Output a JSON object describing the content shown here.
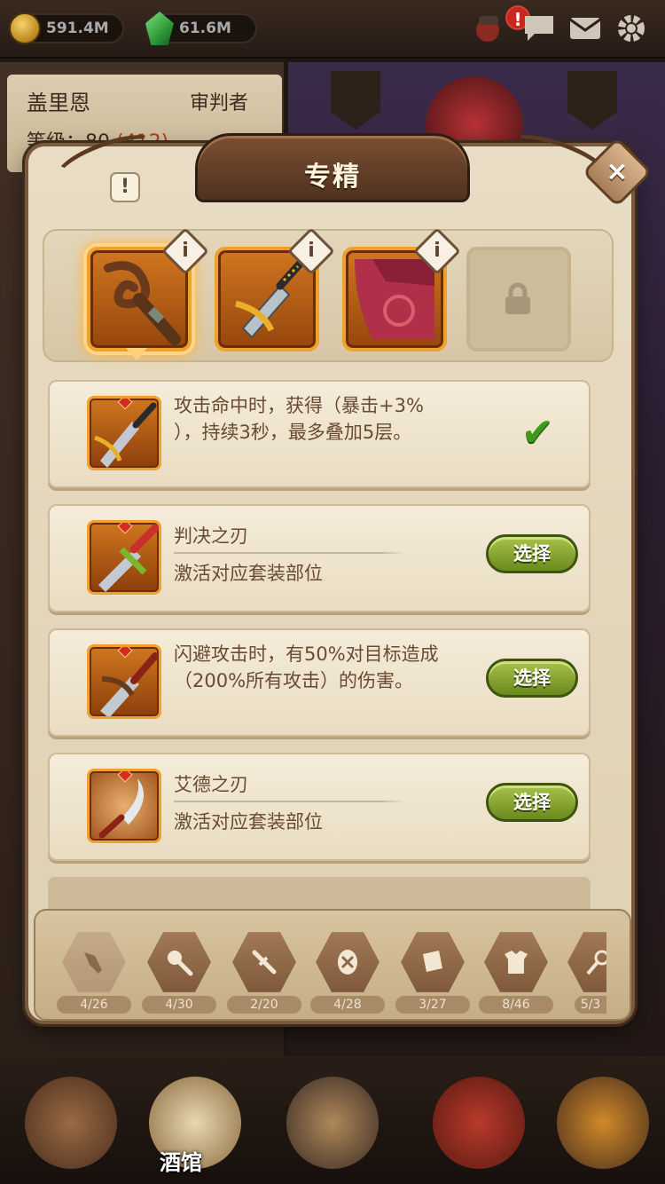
{
  "hud": {
    "gold": "591.4M",
    "gems": "61.6M",
    "alert_badge": "!",
    "icons": [
      "hero-portrait-icon",
      "chat-icon",
      "mail-icon",
      "gear-icon"
    ]
  },
  "hero_card": {
    "name": "盖里恩",
    "role": "审判者",
    "level_label": "等级：80",
    "level_extra": "(412)"
  },
  "dialog": {
    "title": "专精",
    "info_mark": "!",
    "close_label": "×"
  },
  "slots": [
    {
      "icon": "staff-icon",
      "selected": true,
      "info": "i"
    },
    {
      "icon": "dagger-icon",
      "selected": false,
      "info": "i"
    },
    {
      "icon": "cape-icon",
      "selected": false,
      "info": "i"
    },
    {
      "icon": "lock-icon",
      "locked": true
    }
  ],
  "options": [
    {
      "desc_line1": "攻击命中时，获得（暴击+3%",
      "desc_line2": "），持续3秒，最多叠加5层。",
      "state": "selected",
      "icon": "golden-dagger-icon"
    },
    {
      "name": "判决之刃",
      "sub": "激活对应套装部位",
      "button": "选择",
      "icon": "green-sword-icon"
    },
    {
      "desc_line1": "闪避攻击时，有50%对目标造成",
      "desc_line2": "（200%所有攻击）的伤害。",
      "button": "选择",
      "icon": "curved-dagger-icon"
    },
    {
      "name": "艾德之刃",
      "sub": "激活对应套装部位",
      "button": "选择",
      "icon": "scimitar-icon"
    }
  ],
  "categories": [
    {
      "icon": "weapon-icon",
      "count": "4/26"
    },
    {
      "icon": "club-icon",
      "count": "4/30"
    },
    {
      "icon": "sword-icon",
      "count": "2/20"
    },
    {
      "icon": "cross-icon",
      "count": "4/28"
    },
    {
      "icon": "book-icon",
      "count": "3/27"
    },
    {
      "icon": "armor-icon",
      "count": "8/46"
    },
    {
      "icon": "staff-icon",
      "count": "5/3"
    }
  ],
  "bottom_nav": {
    "tavern_label": "酒馆"
  }
}
